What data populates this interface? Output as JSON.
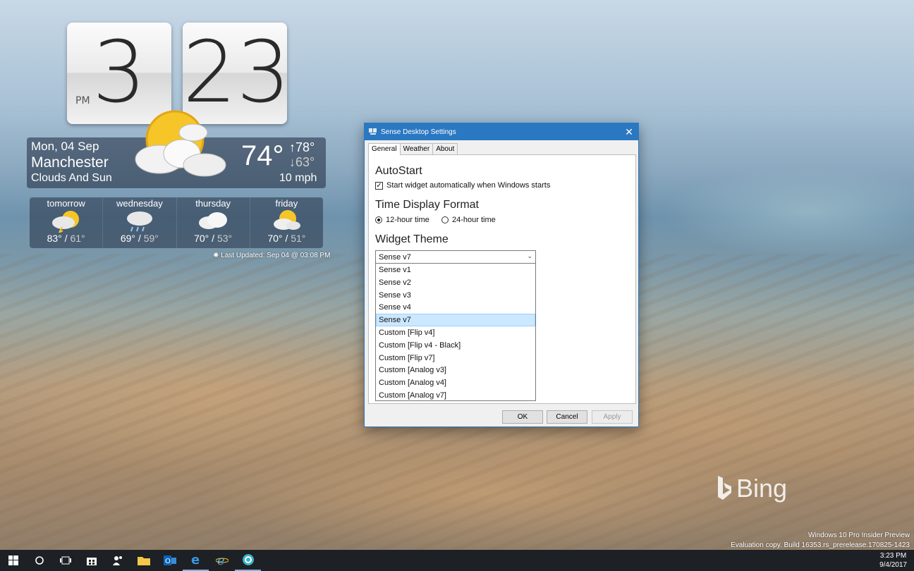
{
  "clock": {
    "hour": "3",
    "minute": "23",
    "ampm": "PM"
  },
  "weather": {
    "date": "Mon, 04 Sep",
    "city": "Manchester",
    "condition": "Clouds And Sun",
    "temp": "74°",
    "high": "↑78°",
    "low": "↓63°",
    "wind": "10 mph",
    "icon": "sun-cloud-icon"
  },
  "forecast": [
    {
      "day": "tomorrow",
      "high": "83°",
      "low": "61°",
      "icon": "storm-sun-icon"
    },
    {
      "day": "wednesday",
      "high": "69°",
      "low": "59°",
      "icon": "rain-cloud-icon"
    },
    {
      "day": "thursday",
      "high": "70°",
      "low": "53°",
      "icon": "cloud-icon"
    },
    {
      "day": "friday",
      "high": "70°",
      "low": "51°",
      "icon": "sun-cloud-icon"
    }
  ],
  "last_updated": "Last Updated: Sep 04 @ 03:08 PM",
  "dialog": {
    "title": "Sense Desktop Settings",
    "tabs": [
      "General",
      "Weather",
      "About"
    ],
    "autostart_heading": "AutoStart",
    "autostart_label": "Start widget automatically when Windows starts",
    "autostart_checked": true,
    "time_heading": "Time Display Format",
    "time_12": "12-hour time",
    "time_24": "24-hour time",
    "time_selected": "12-hour time",
    "theme_heading": "Widget Theme",
    "theme_value": "Sense v7",
    "theme_options": [
      "Sense v1",
      "Sense v2",
      "Sense v3",
      "Sense v4",
      "Sense v7",
      "Custom [Flip v4]",
      "Custom [Flip v4 - Black]",
      "Custom [Flip v7]",
      "Custom [Analog v3]",
      "Custom [Analog v4]",
      "Custom [Analog v7]"
    ],
    "buttons": {
      "ok": "OK",
      "cancel": "Cancel",
      "apply": "Apply"
    }
  },
  "desktop": {
    "bing": "Bing",
    "watermark_line1": "Windows 10 Pro Insider Preview",
    "watermark_line2": "Evaluation copy. Build 16353.rs_prerelease.170825-1423"
  },
  "taskbar": {
    "icons": [
      "windows-start-icon",
      "cortana-search-icon",
      "task-view-icon",
      "store-icon",
      "people-icon",
      "file-explorer-icon",
      "outlook-icon",
      "edge-icon",
      "internet-explorer-icon",
      "sense-app-icon"
    ],
    "time": "3:23 PM",
    "date": "9/4/2017"
  },
  "colors": {
    "accent": "#2b78c2",
    "selection": "#cce8ff"
  }
}
